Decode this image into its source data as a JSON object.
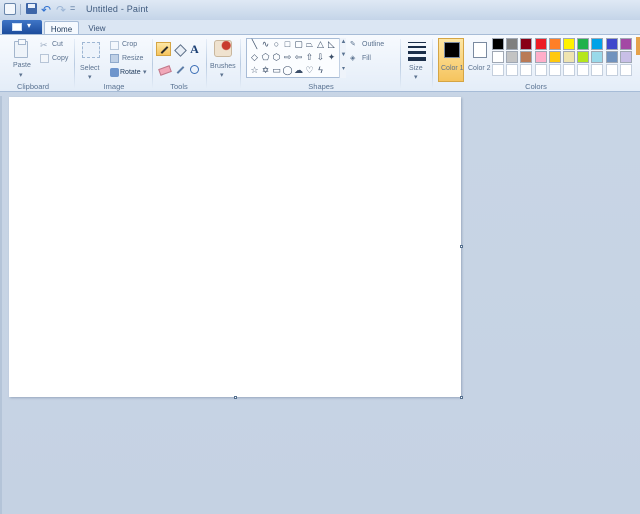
{
  "window": {
    "title": "Untitled - Paint"
  },
  "quick_access": {
    "icons": [
      "app-icon",
      "save-icon",
      "undo-icon",
      "redo-icon",
      "customize-menu-icon"
    ]
  },
  "tabs": [
    {
      "label": "Home",
      "active": true
    },
    {
      "label": "View",
      "active": false
    }
  ],
  "ribbon": {
    "clipboard": {
      "label": "Clipboard",
      "paste": "Paste",
      "cut": "Cut",
      "copy": "Copy"
    },
    "image": {
      "label": "Image",
      "select": "Select",
      "crop": "Crop",
      "resize": "Resize",
      "rotate": "Rotate"
    },
    "tools": {
      "label": "Tools"
    },
    "brushes": {
      "label": "Brushes"
    },
    "shapes": {
      "label": "Shapes",
      "outline": "Outline",
      "fill": "Fill"
    },
    "size": {
      "label": "Size"
    },
    "colors": {
      "label": "Colors",
      "color1_label": "Color 1",
      "color2_label": "Color 2",
      "color1_value": "#000000",
      "color2_value": "#ffffff",
      "row1": [
        "#000000",
        "#7f7f7f",
        "#880015",
        "#ed1c24",
        "#ff7f27",
        "#fff200",
        "#22b14c",
        "#00a2e8",
        "#3f48cc",
        "#a349a4"
      ],
      "row2": [
        "#ffffff",
        "#c3c3c3",
        "#b97a57",
        "#ffaec9",
        "#ffc90e",
        "#efe4b0",
        "#b5e61d",
        "#99d9ea",
        "#7092be",
        "#c8bfe7"
      ]
    }
  },
  "accent": {
    "active_tool": "#f6c45e",
    "ribbon_border": "#a7bcd7"
  }
}
